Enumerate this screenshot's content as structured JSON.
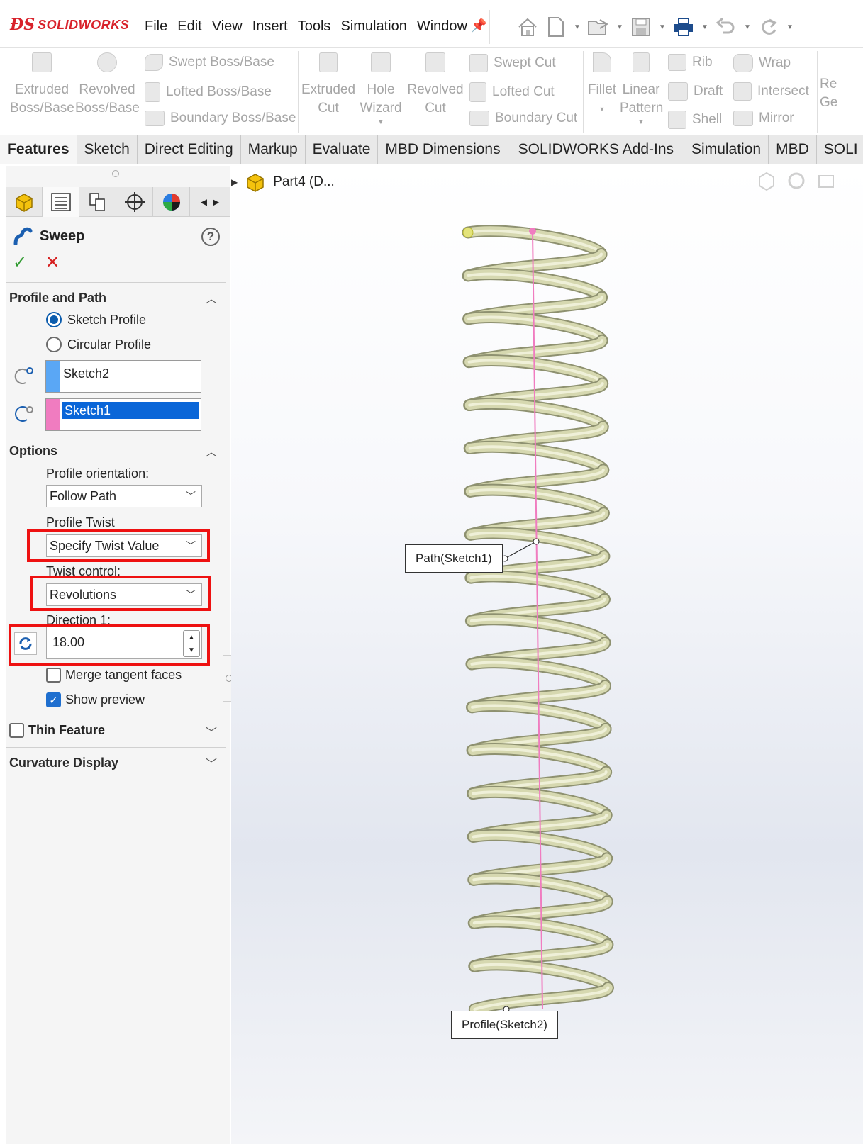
{
  "app": {
    "brand": "SOLIDWORKS",
    "brand_color": "#d8222b"
  },
  "menu": [
    "File",
    "Edit",
    "View",
    "Insert",
    "Tools",
    "Simulation",
    "Window"
  ],
  "quick_access": [
    "home-icon",
    "new-document-icon",
    "open-icon",
    "save-icon",
    "print-icon",
    "undo-icon",
    "redo-icon"
  ],
  "command_manager": {
    "extruded_boss": "Extruded\nBoss/Base",
    "revolved_boss": "Revolved\nBoss/Base",
    "swept_boss": "Swept Boss/Base",
    "lofted_boss": "Lofted Boss/Base",
    "boundary_boss": "Boundary Boss/Base",
    "extruded_cut": "Extruded\nCut",
    "hole_wizard": "Hole\nWizard",
    "revolved_cut": "Revolved\nCut",
    "swept_cut": "Swept Cut",
    "lofted_cut": "Lofted Cut",
    "boundary_cut": "Boundary Cut",
    "fillet": "Fillet",
    "linear_pattern": "Linear\nPattern",
    "rib": "Rib",
    "draft": "Draft",
    "shell": "Shell",
    "wrap": "Wrap",
    "intersect": "Intersect",
    "mirror": "Mirror",
    "clipped": "Re\nGe"
  },
  "tabs": [
    "Features",
    "Sketch",
    "Direct Editing",
    "Markup",
    "Evaluate",
    "MBD Dimensions",
    "SOLIDWORKS Add-Ins",
    "Simulation",
    "MBD",
    "SOLI"
  ],
  "active_tab": "Features",
  "property_manager": {
    "title": "Sweep",
    "profile_and_path": {
      "heading": "Profile and Path",
      "sketch_profile": "Sketch Profile",
      "circular_profile": "Circular Profile",
      "profile_value": "Sketch2",
      "path_value": "Sketch1",
      "profile_color": "#5aa7f5",
      "path_color": "#f07cc0"
    },
    "options": {
      "heading": "Options",
      "profile_orientation_label": "Profile orientation:",
      "profile_orientation_value": "Follow Path",
      "profile_twist_label": "Profile Twist",
      "profile_twist_value": "Specify Twist Value",
      "twist_control_label": "Twist control:",
      "twist_control_value": "Revolutions",
      "direction_label": "Direction 1:",
      "direction_value": "18.00",
      "merge_tangent_faces": "Merge tangent faces",
      "show_preview": "Show preview",
      "merge_checked": false,
      "preview_checked": true
    },
    "thin_feature": "Thin Feature",
    "curvature_display": "Curvature Display"
  },
  "graphics": {
    "part_name": "Part4 (D...",
    "path_callout": "Path(Sketch1)",
    "profile_callout": "Profile(Sketch2)",
    "spring_color": "#d6d8b0",
    "path_line_color": "#f07cc0",
    "turns": 18
  },
  "highlight_color": "#ee1111"
}
